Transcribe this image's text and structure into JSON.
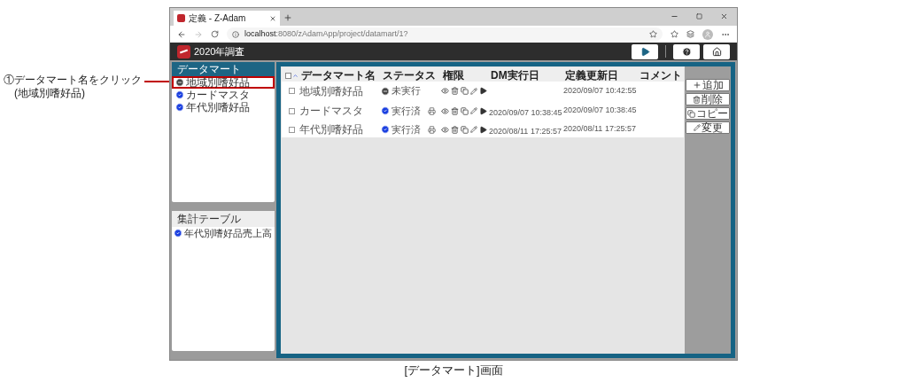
{
  "annotation": {
    "lines": [
      "①データマート名をクリック",
      "(地域別嗜好品)"
    ]
  },
  "browser": {
    "tab_title": "定義 - Z-Adam",
    "url_host": "localhost",
    "url_path": ":8080/zAdamApp/project/datamart/1?"
  },
  "app": {
    "title": "2020年調査"
  },
  "datamart_panel": {
    "title": "データマート",
    "items": [
      {
        "label": "地域別嗜好品",
        "kind": "pending",
        "highlighted": true
      },
      {
        "label": "カードマスタ",
        "kind": "done",
        "highlighted": false
      },
      {
        "label": "年代別嗜好品",
        "kind": "done",
        "highlighted": false
      }
    ]
  },
  "summary_panel": {
    "title": "集計テーブル",
    "items": [
      {
        "label": "年代別嗜好品売上高",
        "kind": "done"
      }
    ]
  },
  "table": {
    "select_all_checked": false,
    "columns": [
      "データマート名",
      "ステータス",
      "権限",
      "DM実行日",
      "定義更新日",
      "コメント"
    ],
    "rows": [
      {
        "checked": false,
        "name": "地域別嗜好品",
        "kind": "pending",
        "status": "未実行",
        "printable": false,
        "dm_date": "",
        "updated": "2020/09/07 10:42:55"
      },
      {
        "checked": false,
        "name": "カードマスタ",
        "kind": "done",
        "status": "実行済",
        "printable": true,
        "dm_date": "2020/09/07 10:38:45",
        "updated": "2020/09/07 10:38:45"
      },
      {
        "checked": false,
        "name": "年代別嗜好品",
        "kind": "done",
        "status": "実行済",
        "printable": true,
        "dm_date": "2020/08/11 17:25:57",
        "updated": "2020/08/11 17:25:57"
      }
    ]
  },
  "side_buttons": [
    {
      "kind": "add",
      "label": "追加"
    },
    {
      "kind": "delete",
      "label": "削除"
    },
    {
      "kind": "copy",
      "label": "コピー"
    },
    {
      "kind": "edit",
      "label": "変更"
    }
  ],
  "caption": "[データマート]画面"
}
